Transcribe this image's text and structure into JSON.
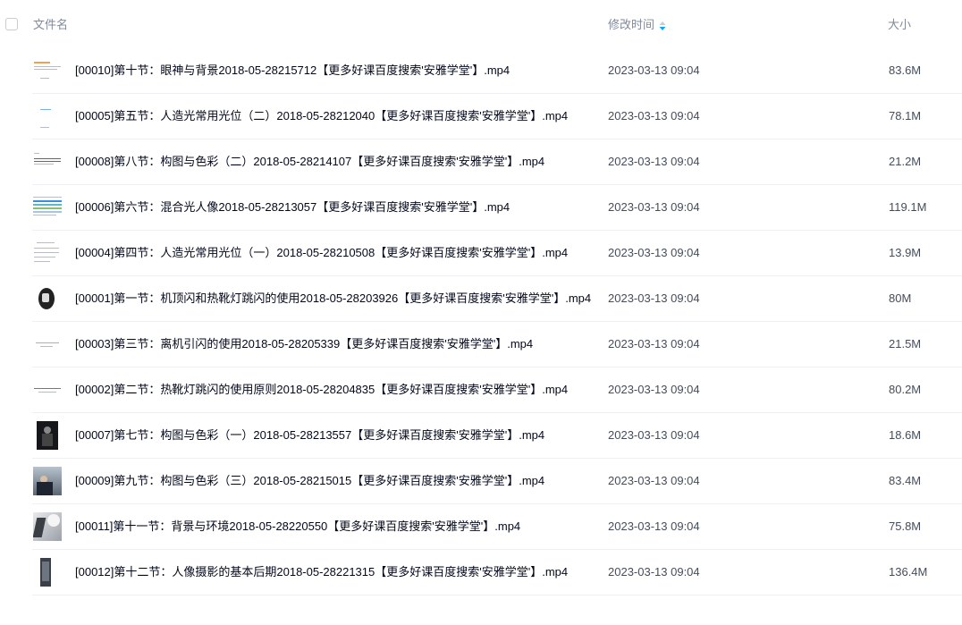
{
  "header": {
    "col_name": "文件名",
    "col_time": "修改时间",
    "col_size": "大小"
  },
  "colors": {
    "sort_icon_top": "#c9ccd4",
    "sort_icon_bottom": "#06a7ff",
    "divider": "#eef0f4"
  },
  "files": [
    {
      "name": "[00010]第十节：眼神与背景2018-05-28215712【更多好课百度搜索'安雅学堂'】.mp4",
      "time": "2023-03-13 09:04",
      "size": "83.6M",
      "thumb": "doc-orange"
    },
    {
      "name": "[00005]第五节：人造光常用光位（二）2018-05-28212040【更多好课百度搜索'安雅学堂'】.mp4",
      "time": "2023-03-13 09:04",
      "size": "78.1M",
      "thumb": "doc-blue"
    },
    {
      "name": "[00008]第八节：构图与色彩（二）2018-05-28214107【更多好课百度搜索'安雅学堂'】.mp4",
      "time": "2023-03-13 09:04",
      "size": "21.2M",
      "thumb": "doc-text"
    },
    {
      "name": "[00006]第六节：混合光人像2018-05-28213057【更多好课百度搜索'安雅学堂'】.mp4",
      "time": "2023-03-13 09:04",
      "size": "119.1M",
      "thumb": "doc-colorful"
    },
    {
      "name": "[00004]第四节：人造光常用光位（一）2018-05-28210508【更多好课百度搜索'安雅学堂'】.mp4",
      "time": "2023-03-13 09:04",
      "size": "13.9M",
      "thumb": "doc-text2"
    },
    {
      "name": "[00001]第一节：机顶闪和热靴灯跳闪的使用2018-05-28203926【更多好课百度搜索'安雅学堂'】.mp4",
      "time": "2023-03-13 09:04",
      "size": "80M",
      "thumb": "photo-flash"
    },
    {
      "name": "[00003]第三节：离机引闪的使用2018-05-28205339【更多好课百度搜索'安雅学堂'】.mp4",
      "time": "2023-03-13 09:04",
      "size": "21.5M",
      "thumb": "doc-orange2"
    },
    {
      "name": "[00002]第二节：热靴灯跳闪的使用原则2018-05-28204835【更多好课百度搜索'安雅学堂'】.mp4",
      "time": "2023-03-13 09:04",
      "size": "80.2M",
      "thumb": "doc-text3"
    },
    {
      "name": "[00007]第七节：构图与色彩（一）2018-05-28213557【更多好课百度搜索'安雅学堂'】.mp4",
      "time": "2023-03-13 09:04",
      "size": "18.6M",
      "thumb": "photo-dark"
    },
    {
      "name": "[00009]第九节：构图与色彩（三）2018-05-28215015【更多好课百度搜索'安雅学堂'】.mp4",
      "time": "2023-03-13 09:04",
      "size": "83.4M",
      "thumb": "photo-man"
    },
    {
      "name": "[00011]第十一节：背景与环境2018-05-28220550【更多好课百度搜索'安雅学堂'】.mp4",
      "time": "2023-03-13 09:04",
      "size": "75.8M",
      "thumb": "photo-light"
    },
    {
      "name": "[00012]第十二节：人像摄影的基本后期2018-05-28221315【更多好课百度搜索'安雅学堂'】.mp4",
      "time": "2023-03-13 09:04",
      "size": "136.4M",
      "thumb": "photo-tower"
    }
  ]
}
